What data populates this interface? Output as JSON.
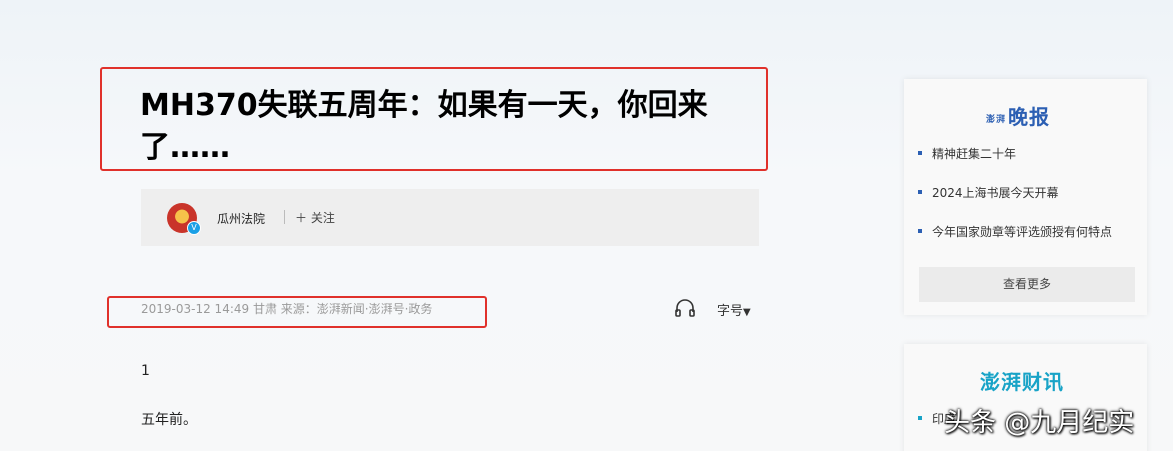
{
  "article": {
    "title": "MH370失联五周年：如果有一天，你回来了……",
    "author": {
      "name": "瓜州法院",
      "verified_badge": "V",
      "follow_label": "关注",
      "follow_icon": "plus-icon"
    },
    "meta": "2019-03-12 14:49  甘肃  来源：澎湃新闻·澎湃号·政务",
    "font_size_label": "字号",
    "paragraphs": [
      "1",
      "五年前。"
    ]
  },
  "sidebar": {
    "evening_news": {
      "logo_small": "澎湃",
      "logo": "晚报",
      "items": [
        "精神赶集二十年",
        "2024上海书展今天开幕",
        "今年国家勋章等评选颁授有何特点"
      ],
      "more_label": "查看更多"
    },
    "caixun": {
      "logo": "澎湃财讯",
      "item": "印度"
    }
  },
  "watermark": "头条 @九月纪实",
  "colors": {
    "highlight_border": "#e0312b",
    "logo_blue": "#2c5fb3",
    "logo_teal": "#18a3c7"
  }
}
